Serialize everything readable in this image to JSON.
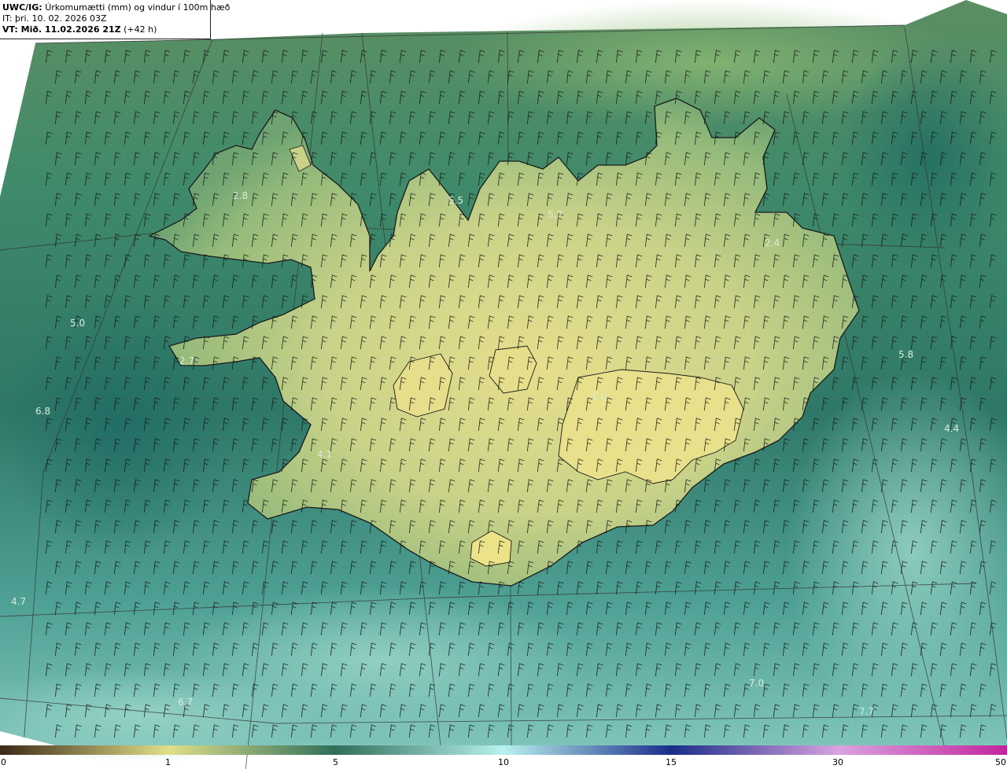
{
  "header": {
    "model": "UWC/IG:",
    "title": "Úrkomumætti (mm) og vindur í 100m hæð",
    "it_line": "IT: þri. 10. 02. 2026 03Z",
    "vt_bold": "VT: Mið. 11.02.2026 21Z",
    "vt_lead": "(+42 h)"
  },
  "field_labels": [
    "5.5",
    "5.7",
    "2.8",
    "2.4",
    "5.0",
    "2.7",
    "6.8",
    "1.0",
    "5.8",
    "4.4",
    "4.1",
    "4.7",
    "7.0",
    "6.7",
    "7.7"
  ],
  "colorbar": {
    "ticks": [
      "0",
      "1",
      "5",
      "10",
      "15",
      "30",
      "50"
    ],
    "colors": [
      "#3b2a17",
      "#8a7a4e",
      "#e0df8a",
      "#2f6f5a",
      "#8ee3dd",
      "#1a2c8a",
      "#d04cc0",
      "#c2259c"
    ]
  },
  "colors": {
    "sea_deep": "#2f7868",
    "sea_light": "#7fc7bd",
    "land_high": "#e3dd8a",
    "land_mid": "#9fc07c",
    "coast": "#1a1a1a",
    "graticule": "#333333"
  }
}
